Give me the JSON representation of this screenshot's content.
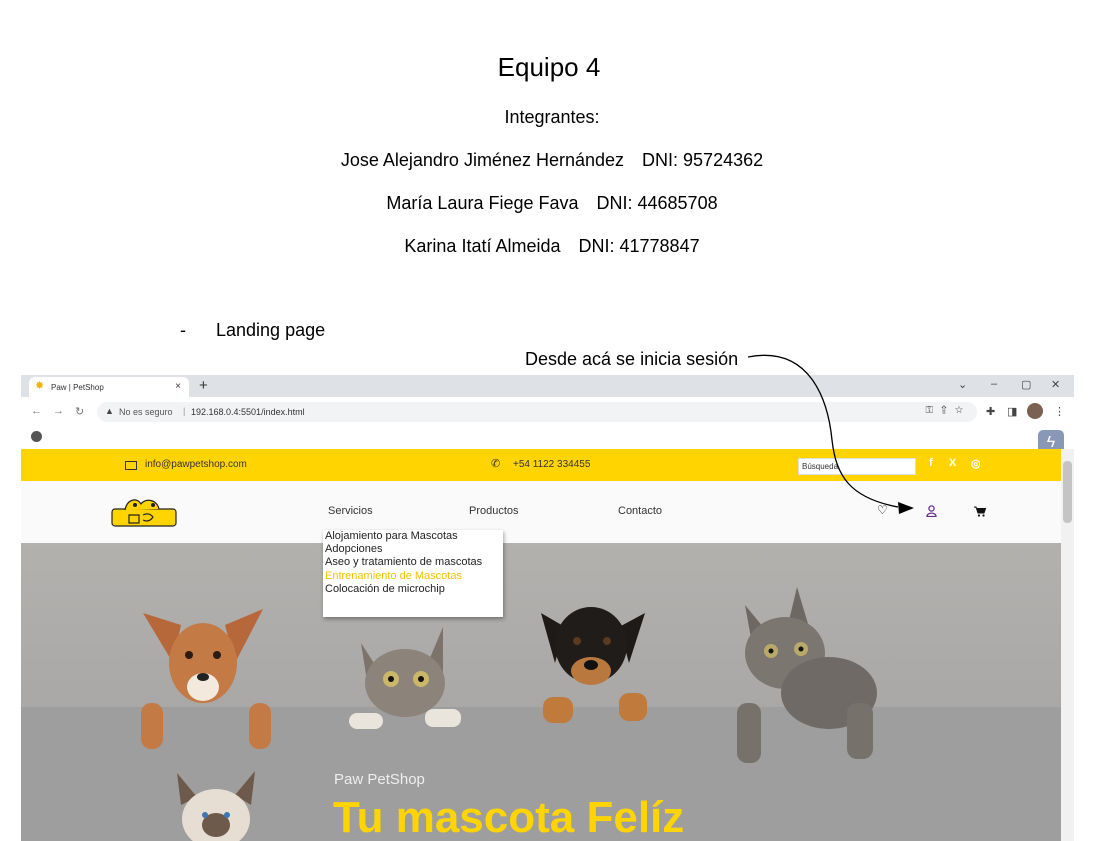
{
  "document": {
    "title": "Equipo 4",
    "subtitle": "Integrantes:",
    "members": [
      {
        "name": "Jose Alejandro Jiménez Hernández",
        "dni": "DNI: 95724362"
      },
      {
        "name": "María Laura Fiege Fava",
        "dni": "DNI: 44685708"
      },
      {
        "name": "Karina Itatí Almeida",
        "dni": "DNI: 41778847"
      }
    ],
    "bullet_dash": "-",
    "bullet": "Landing page",
    "annotation": "Desde acá se inicia sesión"
  },
  "browser": {
    "tab_title": "Paw | PetShop",
    "tab_close": "×",
    "new_tab": "+",
    "not_secure": "No es seguro",
    "address_sep": "|",
    "url": "192.168.0.4:5501/index.html"
  },
  "site": {
    "email": "info@pawpetshop.com",
    "phone": "+54 1122 334455",
    "search_placeholder": "Búsqueda",
    "social": [
      "f",
      "X",
      "◎"
    ],
    "nav": [
      "Servicios",
      "Productos",
      "Contacto"
    ],
    "services_menu": [
      "Alojamiento para Mascotas",
      "Adopciones",
      "Aseo y tratamiento de mascotas",
      "Entrenamiento de Mascotas",
      "Colocación de microchip"
    ],
    "hero_sub": "Paw PetShop",
    "hero_title": "Tu mascota Felíz",
    "highlight_color": "#ffd400"
  }
}
